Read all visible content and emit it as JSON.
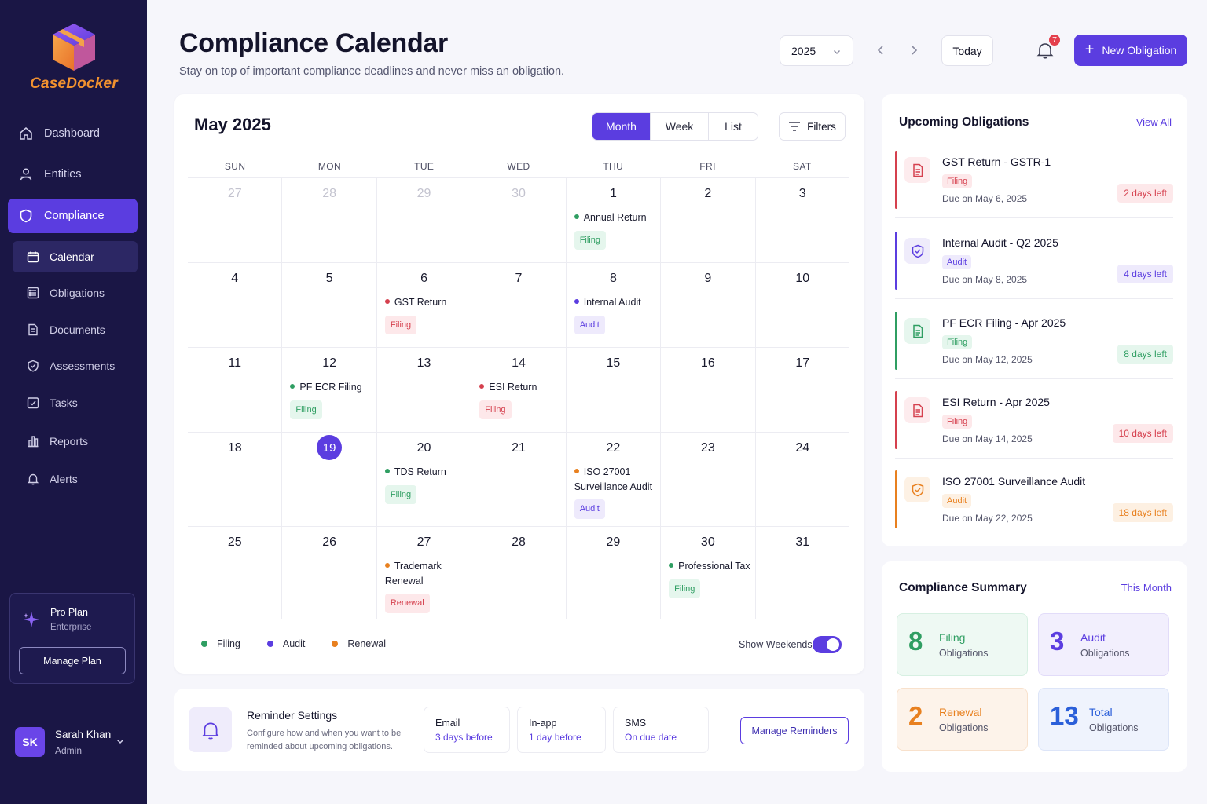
{
  "brand": {
    "name": "CaseDocker",
    "accent": "#5b3de0",
    "logo_color": "#f2922f"
  },
  "sidebar": {
    "nav": [
      {
        "label": "Dashboard",
        "icon": "home-icon"
      },
      {
        "label": "Entities",
        "icon": "users-icon"
      },
      {
        "label": "Compliance",
        "icon": "shield-icon",
        "active": true
      }
    ],
    "sub": [
      {
        "label": "Calendar",
        "icon": "calendar-icon",
        "active": true
      },
      {
        "label": "Obligations",
        "icon": "list-icon"
      },
      {
        "label": "Documents",
        "icon": "document-icon"
      },
      {
        "label": "Assessments",
        "icon": "shield-check-icon"
      },
      {
        "label": "Tasks",
        "icon": "checkbox-icon"
      },
      {
        "label": "Reports",
        "icon": "bar-chart-icon"
      },
      {
        "label": "Alerts",
        "icon": "bell-icon"
      }
    ],
    "plan": {
      "name": "Pro Plan",
      "tier": "Enterprise",
      "button": "Manage Plan"
    },
    "user": {
      "initials": "SK",
      "name": "Sarah Khan",
      "role": "Admin"
    }
  },
  "header": {
    "title": "Compliance Calendar",
    "subtitle": "Stay on top of important compliance deadlines and never miss an obligation.",
    "year": "2025",
    "today": "Today",
    "notifications": "7",
    "new_button": "New Obligation"
  },
  "calendar": {
    "month_label": "May 2025",
    "views": [
      "Month",
      "Week",
      "List"
    ],
    "active_view": "Month",
    "filters": "Filters",
    "weekdays": [
      "SUN",
      "MON",
      "TUE",
      "WED",
      "THU",
      "FRI",
      "SAT"
    ],
    "weeks": [
      [
        {
          "d": "27",
          "m": true
        },
        {
          "d": "28",
          "m": true
        },
        {
          "d": "29",
          "m": true
        },
        {
          "d": "30",
          "m": true
        },
        {
          "d": "1",
          "event": {
            "title": "Annual Return",
            "dot": "#2f9e62",
            "tag": "Filing",
            "tagClass": "filing-green"
          }
        },
        {
          "d": "2"
        },
        {
          "d": "3"
        }
      ],
      [
        {
          "d": "4"
        },
        {
          "d": "5"
        },
        {
          "d": "6",
          "event": {
            "title": "GST Return",
            "dot": "#d5404e",
            "tag": "Filing",
            "tagClass": "filing-red"
          }
        },
        {
          "d": "7"
        },
        {
          "d": "8",
          "event": {
            "title": "Internal Audit",
            "dot": "#5b3de0",
            "tag": "Audit",
            "tagClass": "audit"
          }
        },
        {
          "d": "9"
        },
        {
          "d": "10"
        }
      ],
      [
        {
          "d": "11"
        },
        {
          "d": "12",
          "event": {
            "title": "PF ECR Filing",
            "dot": "#2f9e62",
            "tag": "Filing",
            "tagClass": "filing-green"
          }
        },
        {
          "d": "13"
        },
        {
          "d": "14",
          "event": {
            "title": "ESI Return",
            "dot": "#d5404e",
            "tag": "Filing",
            "tagClass": "filing-red"
          }
        },
        {
          "d": "15"
        },
        {
          "d": "16"
        },
        {
          "d": "17"
        }
      ],
      [
        {
          "d": "18"
        },
        {
          "d": "19",
          "today": true
        },
        {
          "d": "20",
          "event": {
            "title": "TDS Return",
            "dot": "#2f9e62",
            "tag": "Filing",
            "tagClass": "filing-green"
          }
        },
        {
          "d": "21"
        },
        {
          "d": "22",
          "event": {
            "title": "ISO 27001 Surveillance Audit",
            "dot": "#e8801f",
            "tag": "Audit",
            "tagClass": "audit"
          }
        },
        {
          "d": "23"
        },
        {
          "d": "24"
        }
      ],
      [
        {
          "d": "25"
        },
        {
          "d": "26"
        },
        {
          "d": "27",
          "event": {
            "title": "Trademark Renewal",
            "dot": "#e8801f",
            "tag": "Renewal",
            "tagClass": "renewal"
          }
        },
        {
          "d": "28"
        },
        {
          "d": "29"
        },
        {
          "d": "30",
          "event": {
            "title": "Professional Tax",
            "dot": "#2f9e62",
            "tag": "Filing",
            "tagClass": "filing-green"
          }
        },
        {
          "d": "31"
        }
      ]
    ],
    "legend": [
      {
        "label": "Filing",
        "color": "#2f9e62"
      },
      {
        "label": "Audit",
        "color": "#5b3de0"
      },
      {
        "label": "Renewal",
        "color": "#e8801f"
      }
    ],
    "show_weekends_label": "Show Weekends",
    "show_weekends": true
  },
  "reminders": {
    "title": "Reminder Settings",
    "description": "Configure how and when you want to be reminded about upcoming obligations.",
    "channels": [
      {
        "channel": "Email",
        "when": "3 days before"
      },
      {
        "channel": "In-app",
        "when": "1 day before"
      },
      {
        "channel": "SMS",
        "when": "On due date"
      }
    ],
    "button": "Manage Reminders"
  },
  "upcoming": {
    "title": "Upcoming Obligations",
    "view_all": "View All",
    "items": [
      {
        "name": "GST Return - GSTR-1",
        "tag": "Filing",
        "due": "Due on May 6, 2025",
        "days": "2 days left",
        "color": "#d5404e",
        "tone": "red",
        "icon": "document-icon"
      },
      {
        "name": "Internal Audit - Q2 2025",
        "tag": "Audit",
        "due": "Due on May 8, 2025",
        "days": "4 days left",
        "color": "#5b3de0",
        "tone": "purple",
        "icon": "shield-check-icon"
      },
      {
        "name": "PF ECR Filing - Apr 2025",
        "tag": "Filing",
        "due": "Due on May 12, 2025",
        "days": "8 days left",
        "color": "#2f9e62",
        "tone": "green",
        "icon": "document-icon"
      },
      {
        "name": "ESI Return - Apr 2025",
        "tag": "Filing",
        "due": "Due on May 14, 2025",
        "days": "10 days left",
        "color": "#d5404e",
        "tone": "red",
        "icon": "document-icon"
      },
      {
        "name": "ISO 27001 Surveillance Audit",
        "tag": "Audit",
        "due": "Due on May 22, 2025",
        "days": "18 days left",
        "color": "#e8801f",
        "tone": "orange",
        "icon": "shield-check-icon"
      }
    ]
  },
  "summary": {
    "title": "Compliance Summary",
    "period": "This Month",
    "boxes": [
      {
        "num": "8",
        "label": "Filing",
        "sub": "Obligations",
        "tone": "green"
      },
      {
        "num": "3",
        "label": "Audit",
        "sub": "Obligations",
        "tone": "purple"
      },
      {
        "num": "2",
        "label": "Renewal",
        "sub": "Obligations",
        "tone": "orange"
      },
      {
        "num": "13",
        "label": "Total",
        "sub": "Obligations",
        "tone": "blue"
      }
    ]
  }
}
